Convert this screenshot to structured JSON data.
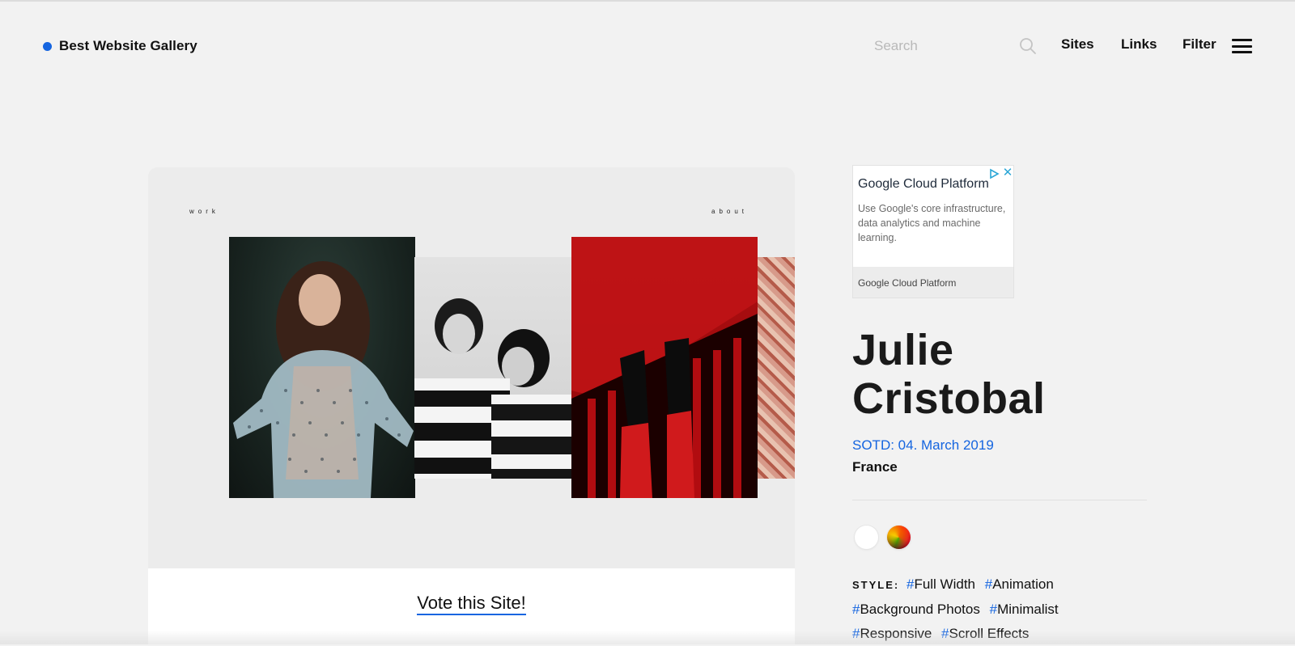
{
  "header": {
    "brand": "Best Website Gallery",
    "search_placeholder": "Search",
    "nav": {
      "sites": "Sites",
      "links": "Links",
      "filter": "Filter"
    }
  },
  "preview": {
    "mini_nav": {
      "work": "work",
      "about": "about"
    },
    "vote_label": "Vote this Site!"
  },
  "ad": {
    "title": "Google Cloud Platform",
    "body": "Use Google's core infrastructure, data analytics and machine learning.",
    "footer": "Google Cloud Platform"
  },
  "site": {
    "title_line1": "Julie",
    "title_line2": "Cristobal",
    "sotd": "SOTD: 04. March 2019",
    "country": "France"
  },
  "swatches": [
    {
      "name": "white",
      "color": "#ffffff"
    },
    {
      "name": "multicolor",
      "color": "gradient"
    }
  ],
  "style": {
    "label": "STYLE:",
    "tags": [
      "Full Width",
      "Animation",
      "Background Photos",
      "Minimalist",
      "Responsive",
      "Scroll Effects"
    ]
  },
  "colors": {
    "accent": "#1565e0",
    "background": "#f2f2f2"
  }
}
